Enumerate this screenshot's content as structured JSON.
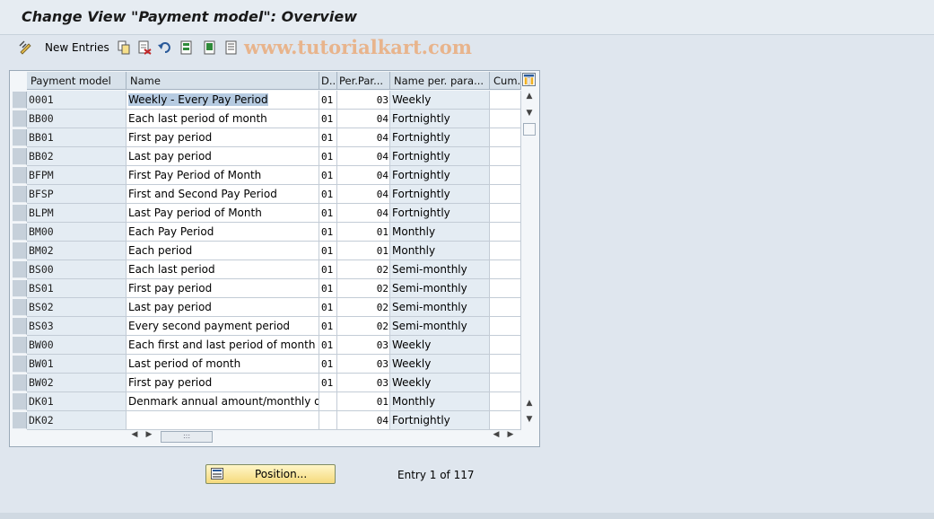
{
  "title": "Change View \"Payment model\": Overview",
  "toolbar": {
    "new_entries": "New Entries",
    "watermark": "www.tutorialkart.com"
  },
  "columns": {
    "payment_model": "Payment model",
    "name": "Name",
    "d": "D..",
    "per_par": "Per.Par...",
    "name_per_para": "Name per. para...",
    "cum": "Cum..."
  },
  "rows": [
    {
      "code": "0001",
      "name": "Weekly - Every Pay Period",
      "d": "01",
      "per": "03",
      "npp": "Weekly"
    },
    {
      "code": "BB00",
      "name": "Each last period of month",
      "d": "01",
      "per": "04",
      "npp": "Fortnightly"
    },
    {
      "code": "BB01",
      "name": "First pay period",
      "d": "01",
      "per": "04",
      "npp": "Fortnightly"
    },
    {
      "code": "BB02",
      "name": "Last pay period",
      "d": "01",
      "per": "04",
      "npp": "Fortnightly"
    },
    {
      "code": "BFPM",
      "name": "First Pay Period of Month",
      "d": "01",
      "per": "04",
      "npp": "Fortnightly"
    },
    {
      "code": "BFSP",
      "name": "First and Second Pay Period",
      "d": "01",
      "per": "04",
      "npp": "Fortnightly"
    },
    {
      "code": "BLPM",
      "name": "Last Pay period of Month",
      "d": "01",
      "per": "04",
      "npp": "Fortnightly"
    },
    {
      "code": "BM00",
      "name": "Each Pay Period",
      "d": "01",
      "per": "01",
      "npp": "Monthly"
    },
    {
      "code": "BM02",
      "name": "Each period",
      "d": "01",
      "per": "01",
      "npp": "Monthly"
    },
    {
      "code": "BS00",
      "name": "Each last period",
      "d": "01",
      "per": "02",
      "npp": "Semi-monthly"
    },
    {
      "code": "BS01",
      "name": "First pay period",
      "d": "01",
      "per": "02",
      "npp": "Semi-monthly"
    },
    {
      "code": "BS02",
      "name": "Last pay period",
      "d": "01",
      "per": "02",
      "npp": "Semi-monthly"
    },
    {
      "code": "BS03",
      "name": "Every second payment period",
      "d": "01",
      "per": "02",
      "npp": "Semi-monthly"
    },
    {
      "code": "BW00",
      "name": "Each first and last period of month",
      "d": "01",
      "per": "03",
      "npp": "Weekly"
    },
    {
      "code": "BW01",
      "name": "Last period of month",
      "d": "01",
      "per": "03",
      "npp": "Weekly"
    },
    {
      "code": "BW02",
      "name": "First pay period",
      "d": "01",
      "per": "03",
      "npp": "Weekly"
    },
    {
      "code": "DK01",
      "name": "Denmark annual amount/monthly ded...",
      "d": "",
      "per": "01",
      "npp": "Monthly"
    },
    {
      "code": "DK02",
      "name": "",
      "d": "",
      "per": "04",
      "npp": "Fortnightly"
    }
  ],
  "position_button": "Position...",
  "entry_info": "Entry 1 of 117"
}
